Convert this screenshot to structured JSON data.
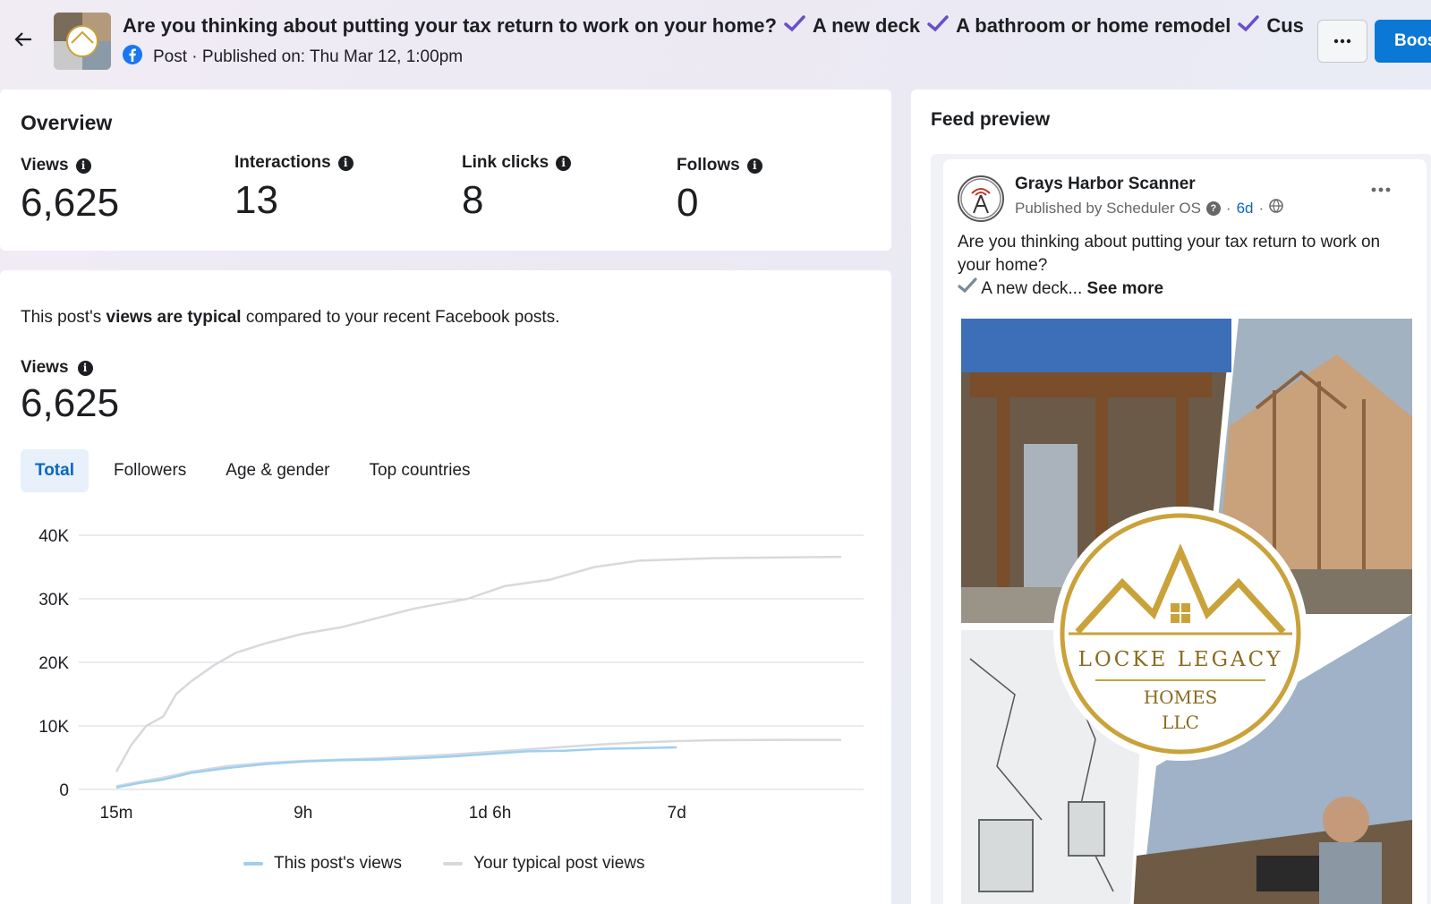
{
  "header": {
    "title_parts": [
      "Are you thinking about putting your tax return to work on your home?",
      "A new deck",
      "A bathroom or home remodel",
      "Custom ..."
    ],
    "post_type": "Post",
    "published": "Published on: Thu Mar 12, 1:00pm",
    "more_label": "···",
    "boost_label": "Boost"
  },
  "overview": {
    "title": "Overview",
    "metrics": [
      {
        "label": "Views",
        "value": "6,625"
      },
      {
        "label": "Interactions",
        "value": "13"
      },
      {
        "label": "Link clicks",
        "value": "8"
      },
      {
        "label": "Follows",
        "value": "0"
      }
    ]
  },
  "views_section": {
    "typical_prefix": "This post's ",
    "typical_bold": "views are typical",
    "typical_suffix": " compared to your recent Facebook posts.",
    "label": "Views",
    "value": "6,625",
    "tabs": [
      "Total",
      "Followers",
      "Age & gender",
      "Top countries"
    ],
    "active_tab": 0
  },
  "chart_data": {
    "type": "line",
    "y_ticks": [
      "40K",
      "30K",
      "20K",
      "10K",
      "0"
    ],
    "ylim": [
      0,
      40000
    ],
    "x_ticks": [
      {
        "label": "15m",
        "pos": 0.0
      },
      {
        "label": "9h",
        "pos": 0.25
      },
      {
        "label": "1d 6h",
        "pos": 0.5
      },
      {
        "label": "7d",
        "pos": 0.75
      }
    ],
    "series": [
      {
        "name": "This post's views",
        "color": "#9ecff0",
        "points": [
          [
            0,
            300
          ],
          [
            0.03,
            1000
          ],
          [
            0.06,
            1500
          ],
          [
            0.1,
            2600
          ],
          [
            0.15,
            3400
          ],
          [
            0.2,
            4000
          ],
          [
            0.25,
            4400
          ],
          [
            0.3,
            4600
          ],
          [
            0.35,
            4700
          ],
          [
            0.4,
            4900
          ],
          [
            0.45,
            5200
          ],
          [
            0.5,
            5600
          ],
          [
            0.55,
            6000
          ],
          [
            0.6,
            6100
          ],
          [
            0.65,
            6400
          ],
          [
            0.7,
            6500
          ],
          [
            0.75,
            6625
          ]
        ]
      },
      {
        "name": "Your typical post views",
        "color": "#d8d9de",
        "points": [
          [
            0,
            500
          ],
          [
            0.03,
            1200
          ],
          [
            0.06,
            1800
          ],
          [
            0.1,
            2800
          ],
          [
            0.15,
            3700
          ],
          [
            0.2,
            4200
          ],
          [
            0.25,
            4500
          ],
          [
            0.3,
            4700
          ],
          [
            0.35,
            4900
          ],
          [
            0.4,
            5200
          ],
          [
            0.45,
            5500
          ],
          [
            0.5,
            5900
          ],
          [
            0.55,
            6300
          ],
          [
            0.6,
            6700
          ],
          [
            0.65,
            7100
          ],
          [
            0.7,
            7400
          ],
          [
            0.75,
            7600
          ],
          [
            0.8,
            7750
          ],
          [
            0.9,
            7800
          ],
          [
            0.97,
            7800
          ]
        ]
      },
      {
        "name": "Your typical post views (upper)",
        "color": "#d8d9de",
        "points": [
          [
            0,
            2800
          ],
          [
            0.02,
            7000
          ],
          [
            0.04,
            10000
          ],
          [
            0.063,
            11500
          ],
          [
            0.08,
            15000
          ],
          [
            0.1,
            17000
          ],
          [
            0.13,
            19500
          ],
          [
            0.16,
            21500
          ],
          [
            0.2,
            23000
          ],
          [
            0.25,
            24500
          ],
          [
            0.3,
            25500
          ],
          [
            0.35,
            27000
          ],
          [
            0.4,
            28500
          ],
          [
            0.47,
            30000
          ],
          [
            0.52,
            32000
          ],
          [
            0.58,
            33000
          ],
          [
            0.64,
            35000
          ],
          [
            0.7,
            36000
          ],
          [
            0.8,
            36400
          ],
          [
            0.97,
            36600
          ]
        ]
      }
    ]
  },
  "feed": {
    "title": "Feed preview",
    "page_name": "Grays Harbor Scanner",
    "published_by": "Published by Scheduler OS",
    "ago": "6d",
    "text_line1": "Are you thinking about putting your tax return to work on your home?",
    "text_line2": "A new deck...",
    "see_more": "See more",
    "logo_text_1": "LOCKE LEGACY",
    "logo_text_2": "HOMES",
    "logo_text_3": "LLC"
  },
  "colors": {
    "accent": "#0a66c2",
    "check": "#6a4fc7",
    "boost": "#0a78d4"
  }
}
